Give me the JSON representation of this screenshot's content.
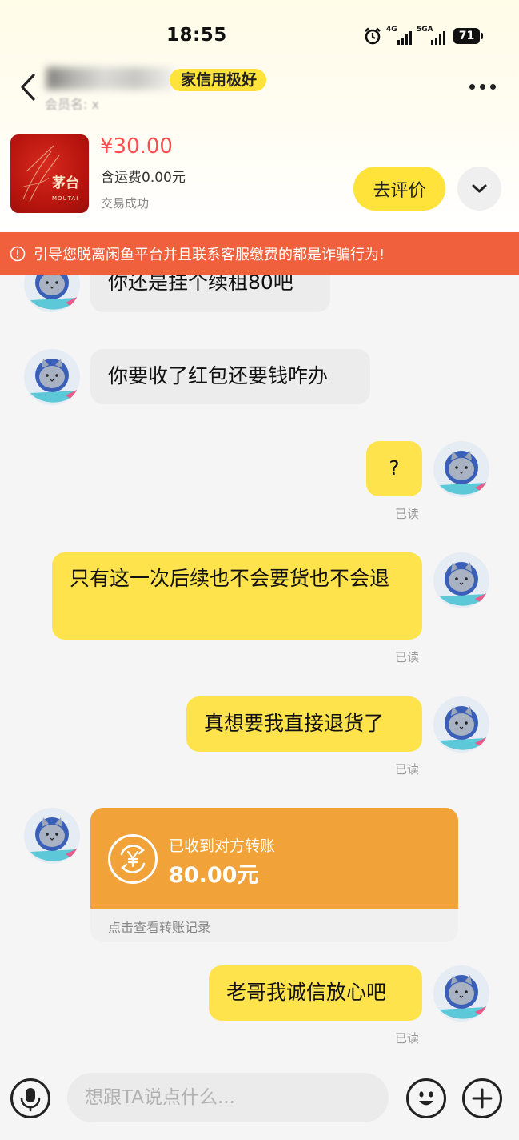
{
  "status_bar": {
    "time": "18:55",
    "net1_label": "4G",
    "net2_label": "5GA",
    "battery": "71"
  },
  "header": {
    "seller_name": "商",
    "credit_badge": "家信用极好",
    "subtitle": "会员名: x"
  },
  "product": {
    "price": "¥30.00",
    "shipping": "含运费0.00元",
    "status": "交易成功",
    "brand_cn": "茅台",
    "brand_en": "MOUTAI",
    "review_button": "去评价"
  },
  "warning": {
    "text": "引导您脱离闲鱼平台并且联系客服缴费的都是诈骗行为!"
  },
  "messages": [
    {
      "side": "left",
      "text": "你还是挂个续租80吧"
    },
    {
      "side": "left",
      "text": "你要收了红包还要钱咋办"
    },
    {
      "side": "right",
      "text": "?",
      "read": "已读"
    },
    {
      "side": "right",
      "text": "只有这一次后续也不会要货也不会退",
      "read": "已读"
    },
    {
      "side": "right",
      "text": "真想要我直接退货了",
      "read": "已读"
    },
    {
      "side": "right",
      "text": "老哥我诚信放心吧",
      "read": "已读"
    }
  ],
  "transfer": {
    "title": "已收到对方转账",
    "amount": "80.00元",
    "link": "点击查看转账记录"
  },
  "input_bar": {
    "placeholder": "想跟TA说点什么..."
  },
  "colors": {
    "accent_yellow": "#ffe34c",
    "warning_red": "#f0603d",
    "price_red": "#ff4d4f",
    "transfer_orange": "#f1a33a"
  }
}
